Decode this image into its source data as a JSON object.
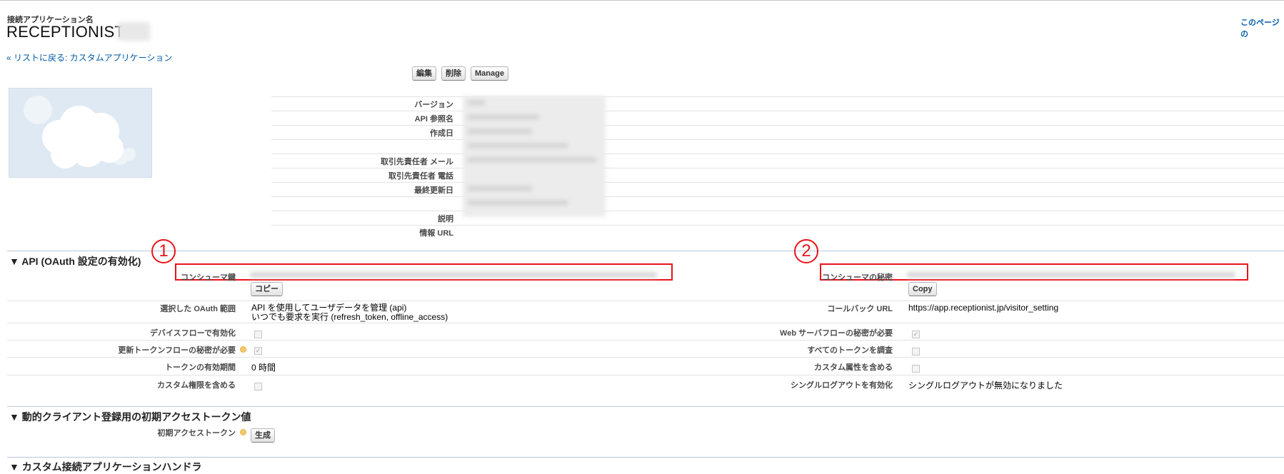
{
  "header": {
    "sub_label": "接続アプリケーション名",
    "app_name": "RECEPTIONIST",
    "help_link": "このページの"
  },
  "breadcrumb": {
    "back": "« リストに戻る: カスタムアプリケーション"
  },
  "toolbar": {
    "edit_label": "編集",
    "delete_label": "削除",
    "manage_label": "Manage"
  },
  "details": {
    "version_label": "バージョン",
    "api_name_label": "API 参照名",
    "created_label": "作成日",
    "contact_email_label": "取引先責任者 メール",
    "contact_phone_label": "取引先責任者 電話",
    "last_modified_label": "最終更新日",
    "description_label": "説明",
    "info_url_label": "情報 URL"
  },
  "api_section": {
    "title": "▼ API (OAuth 設定の有効化)",
    "consumer_key_label": "コンシューマ鍵",
    "copy_key_button": "コピー",
    "consumer_secret_label": "コンシューマの秘密",
    "copy_secret_button": "Copy",
    "oauth_scope_label": "選択した OAuth 範囲",
    "oauth_scope_line1": "API を使用してユーザデータを管理 (api)",
    "oauth_scope_line2": "いつでも要求を実行 (refresh_token, offline_access)",
    "callback_url_label": "コールバック URL",
    "callback_url_value": "https://app.receptionist.jp/visitor_setting",
    "device_flow_label": "デバイスフローで有効化",
    "web_server_secret_label": "Web サーバフローの秘密が必要",
    "refresh_secret_label": "更新トークンフローの秘密が必要",
    "introspect_label": "すべてのトークンを調査",
    "token_validity_label": "トークンの有効期間",
    "token_validity_value": "0 時間",
    "custom_attributes_label": "カスタム属性を含める",
    "custom_permissions_label": "カスタム権限を含める",
    "single_logout_label": "シングルログアウトを有効化",
    "single_logout_value": "シングルログアウトが無効になりました"
  },
  "dynamic_section": {
    "title": "▼ 動的クライアント登録用の初期アクセストークン値",
    "initial_token_label": "初期アクセストークン",
    "generate_button": "生成"
  },
  "handler_section": {
    "title": "▼ カスタム接続アプリケーションハンドラ"
  },
  "annotations": {
    "marker_1": "1",
    "marker_2": "2"
  },
  "colors": {
    "link": "#015ba7",
    "annotation_red": "#e8131c",
    "section_rule": "#b8c7d6"
  }
}
